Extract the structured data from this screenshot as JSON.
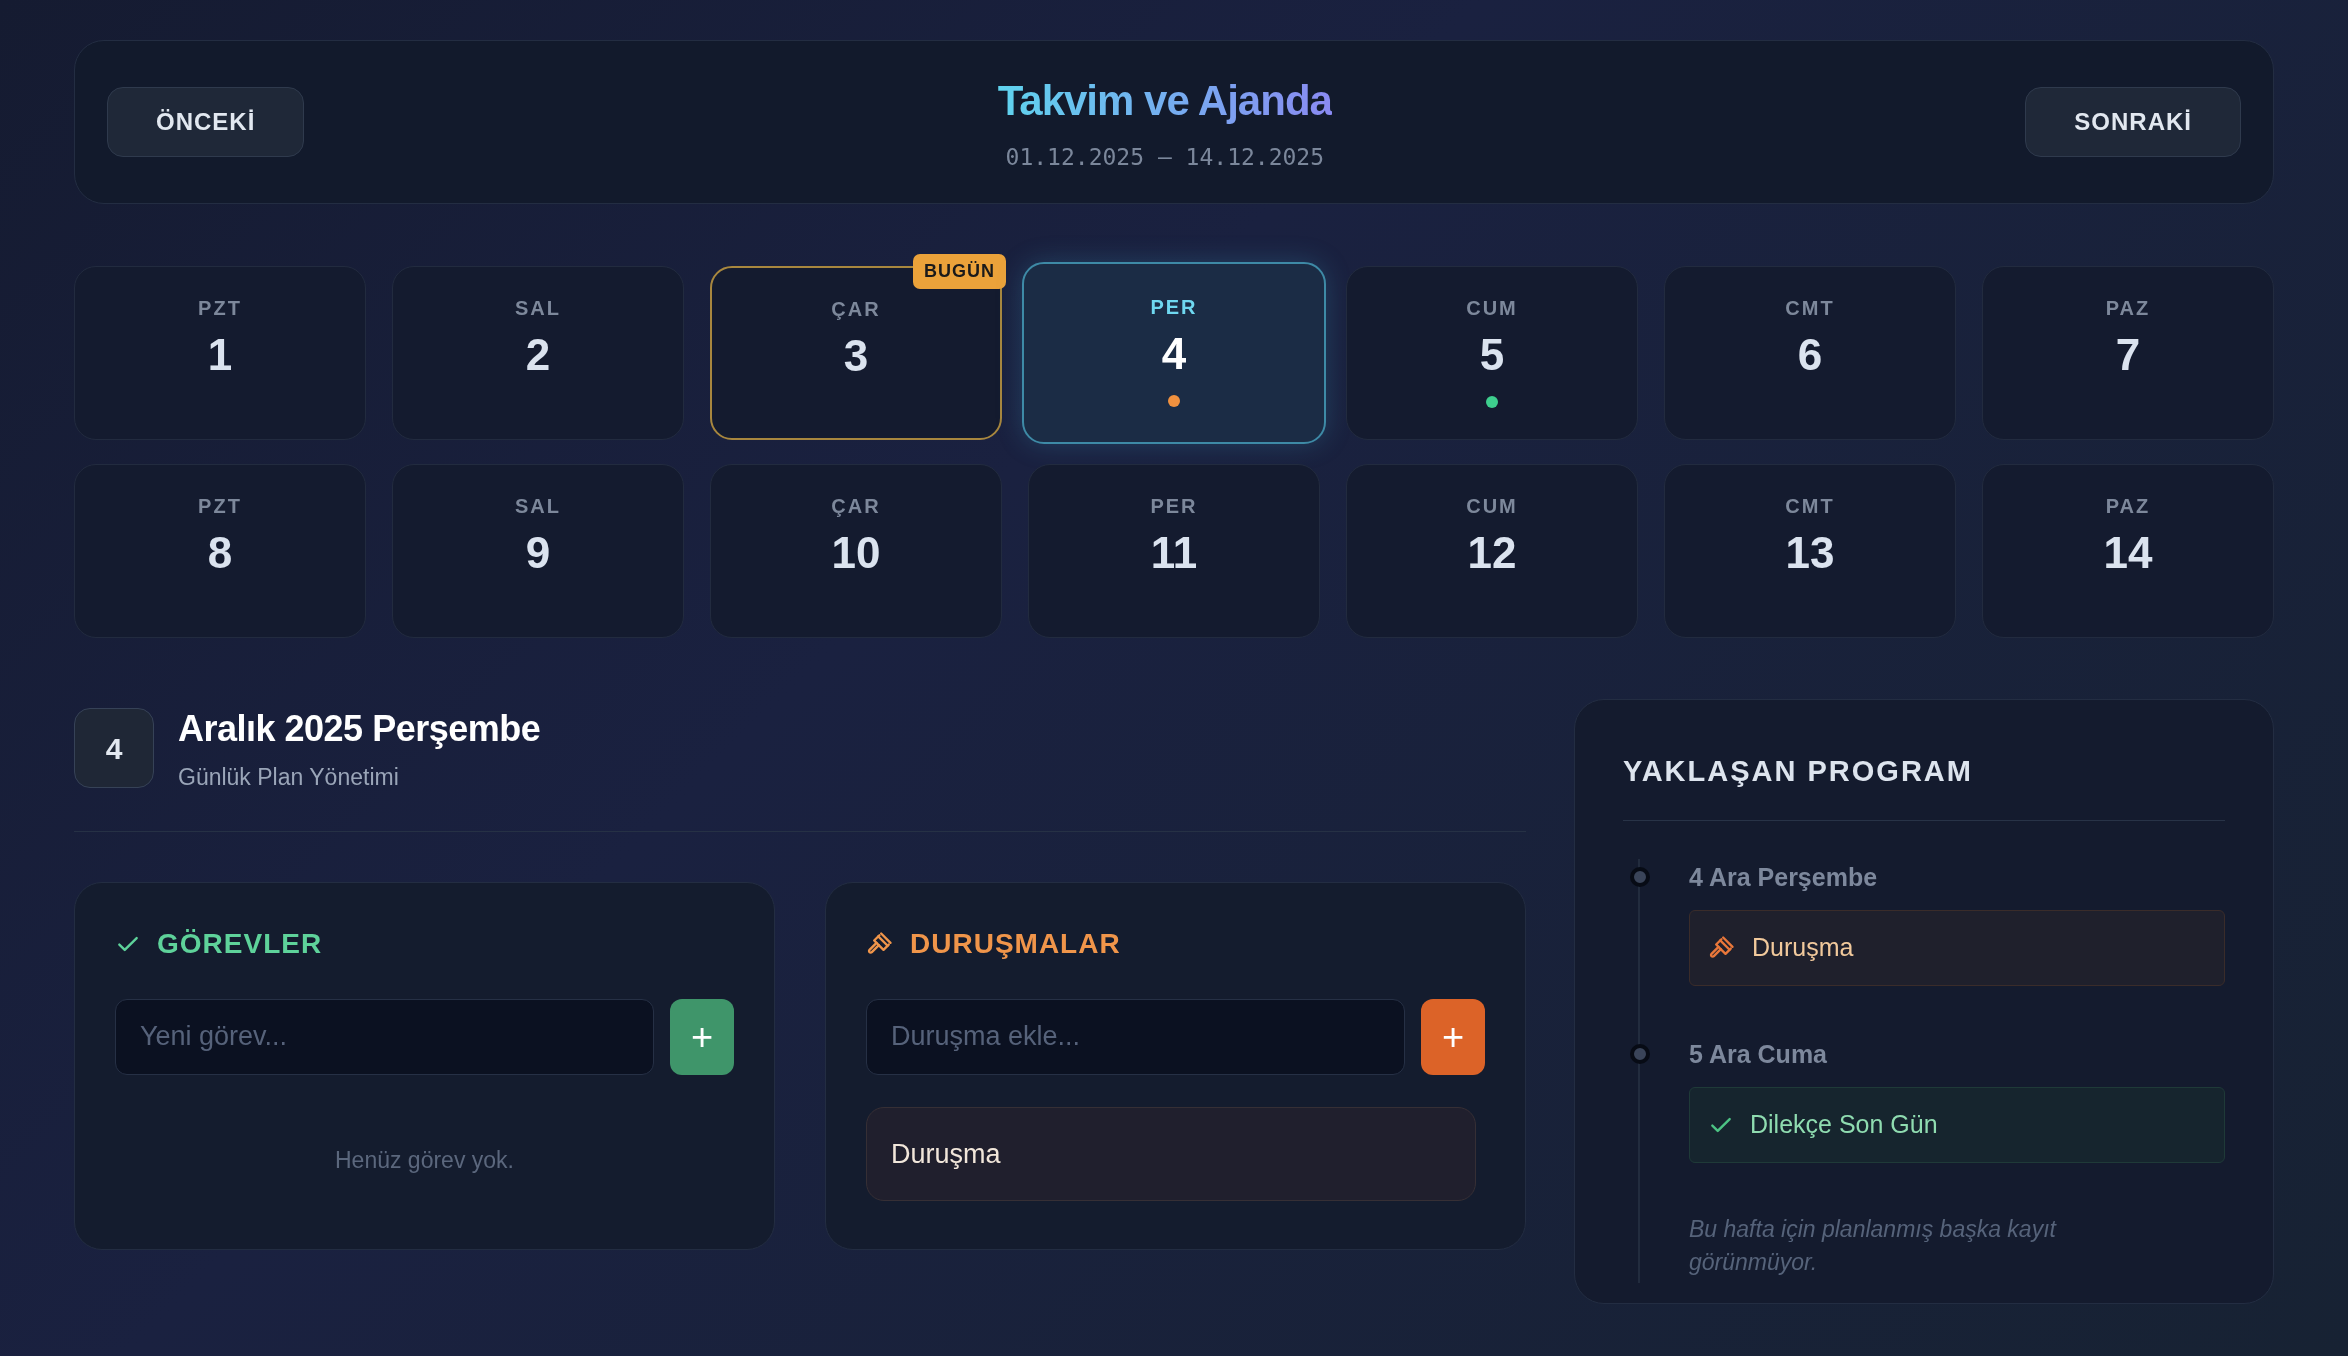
{
  "header": {
    "prev_button": "ÖNCEKİ",
    "title": "Takvim ve Ajanda",
    "date_range": "01.12.2025 — 14.12.2025",
    "next_button": "SONRAKİ"
  },
  "days": [
    {
      "weekday": "PZT",
      "day": "1",
      "today": false,
      "selected": false
    },
    {
      "weekday": "SAL",
      "day": "2",
      "today": false,
      "selected": false
    },
    {
      "weekday": "ÇAR",
      "day": "3",
      "today": true,
      "selected": false,
      "badge": "BUGÜN"
    },
    {
      "weekday": "PER",
      "day": "4",
      "today": false,
      "selected": true,
      "color": "#f0913f"
    },
    {
      "weekday": "CUM",
      "day": "5",
      "today": false,
      "selected": false,
      "color": "#3ecf8e"
    },
    {
      "weekday": "CMT",
      "day": "6",
      "today": false,
      "selected": false
    },
    {
      "weekday": "PAZ",
      "day": "7",
      "today": false,
      "selected": false
    },
    {
      "weekday": "PZT",
      "day": "8",
      "today": false,
      "selected": false
    },
    {
      "weekday": "SAL",
      "day": "9",
      "today": false,
      "selected": false
    },
    {
      "weekday": "ÇAR",
      "day": "10",
      "today": false,
      "selected": false
    },
    {
      "weekday": "PER",
      "day": "11",
      "today": false,
      "selected": false
    },
    {
      "weekday": "CUM",
      "day": "12",
      "today": false,
      "selected": false
    },
    {
      "weekday": "CMT",
      "day": "13",
      "today": false,
      "selected": false
    },
    {
      "weekday": "PAZ",
      "day": "14",
      "today": false,
      "selected": false
    }
  ],
  "selected_day": {
    "number": "4",
    "title": "Aralık 2025 Perşembe",
    "subtitle": "Günlük Plan Yönetimi"
  },
  "panels": [
    {
      "kind": "tasks",
      "title": "GÖREVLER",
      "placeholder": "Yeni görev...",
      "add_label": "+",
      "empty_text": "Henüz görev yok."
    },
    {
      "kind": "hearings",
      "title": "DURUŞMALAR",
      "placeholder": "Duruşma ekle...",
      "add_label": "+",
      "items": [
        "Duruşma"
      ]
    }
  ],
  "upcoming": {
    "title": "YAKLAŞAN PROGRAM",
    "groups": [
      {
        "date": "4 Ara Perşembe",
        "entries": [
          {
            "kind": "hearing",
            "text": "Duruşma"
          }
        ]
      },
      {
        "date": "5 Ara Cuma",
        "entries": [
          {
            "kind": "task",
            "text": "Dilekçe Son Gün"
          }
        ]
      }
    ],
    "note": "Bu hafta için planlanmış başka kayıt görünmüyor."
  }
}
